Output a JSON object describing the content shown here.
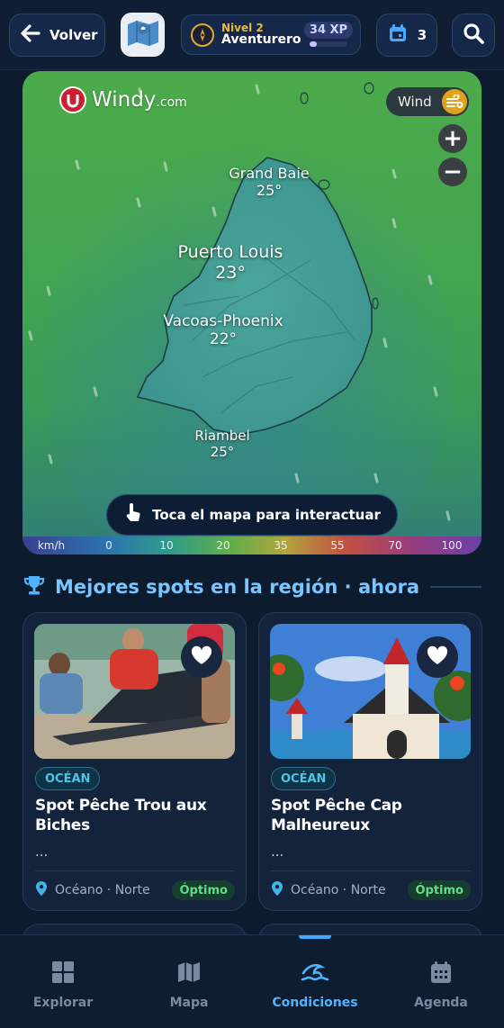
{
  "topbar": {
    "back_label": "Volver",
    "map_button_icon": "map-icon",
    "level_label": "Nivel 2",
    "level_name": "Aventurero",
    "xp": "34 XP",
    "xp_progress": 0.2,
    "calendar_count": "3",
    "search_icon": "search-icon"
  },
  "map": {
    "brand": "Windy",
    "brand_suffix": ".com",
    "layer_label": "Wind",
    "zoom_in": "+",
    "zoom_out": "−",
    "cities": [
      {
        "name": "Grand Baie",
        "temp": "25°"
      },
      {
        "name": "Puerto Louis",
        "temp": "23°"
      },
      {
        "name": "Vacoas-Phoenix",
        "temp": "22°"
      },
      {
        "name": "Riambel",
        "temp": "25°"
      }
    ],
    "interact_label": "Toca el mapa para interactuar",
    "scale": {
      "unit": "km/h",
      "ticks": [
        "0",
        "10",
        "20",
        "35",
        "55",
        "70",
        "100"
      ]
    },
    "colors": {
      "land": "#3e9c55",
      "brand": "#c8202e",
      "wind_icon": "#e1a21b"
    }
  },
  "section": {
    "title": "Mejores spots en la región · ahora",
    "icon": "trophy-icon"
  },
  "spots": [
    {
      "category": "OCÉAN",
      "title": "Spot Pêche Trou aux Biches",
      "description": "...",
      "location": "Océano · Norte",
      "status": "Óptimo"
    },
    {
      "category": "OCÉAN",
      "title": "Spot Pêche Cap Malheureux",
      "description": "...",
      "location": "Océano · Norte",
      "status": "Óptimo"
    }
  ],
  "nav": {
    "items": [
      {
        "label": "Explorar",
        "icon": "grid-icon"
      },
      {
        "label": "Mapa",
        "icon": "map-icon"
      },
      {
        "label": "Condiciones",
        "icon": "waves-icon",
        "active": true
      },
      {
        "label": "Agenda",
        "icon": "calendar-icon"
      }
    ]
  },
  "accent": "#4fb4ff"
}
